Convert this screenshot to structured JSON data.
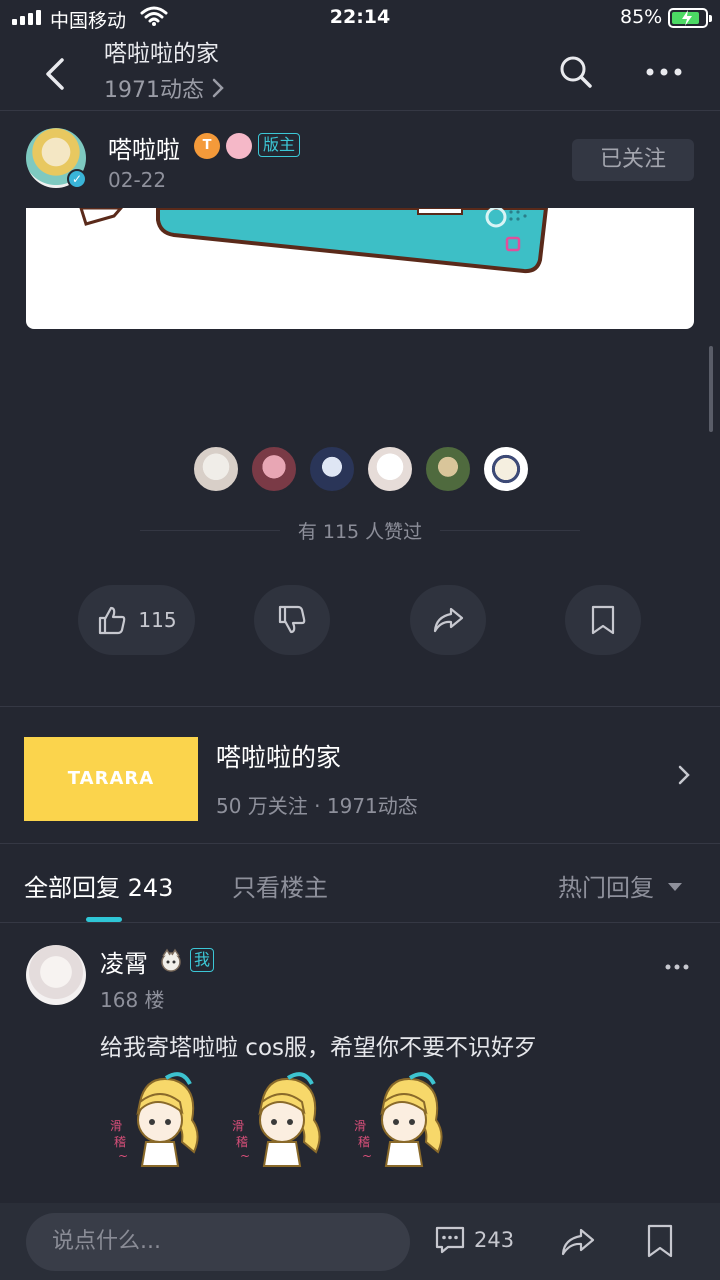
{
  "status_bar": {
    "carrier": "中国移动",
    "time": "22:14",
    "battery_percent": "85%",
    "battery_level": 0.85,
    "charging": true
  },
  "header": {
    "title": "嗒啦啦的家",
    "subtitle": "1971动态",
    "icons": [
      "back-icon",
      "search-icon",
      "more-icon"
    ]
  },
  "post": {
    "author": {
      "name": "嗒啦啦",
      "level_badge": "T",
      "role_badge": "版主",
      "verified": true
    },
    "date": "02-22",
    "follow_label": "已关注",
    "likes_summary": "有 115 人赞过",
    "actions": {
      "like_count": "115",
      "icons": [
        "thumb-up-icon",
        "thumb-down-icon",
        "share-icon",
        "bookmark-icon"
      ]
    }
  },
  "forum": {
    "logo_text": "TARARA",
    "name": "嗒啦啦的家",
    "stats": "50 万关注 · 1971动态",
    "accent": "#fbd44c"
  },
  "tabs": {
    "all_label": "全部回复",
    "all_count": "243",
    "owner_label": "只看楼主",
    "sort_label": "热门回复"
  },
  "comment": {
    "user": "凌霄",
    "me_badge": "我",
    "floor": "168 楼",
    "text": "给我寄塔啦啦 cos服，希望你不要不识好歹"
  },
  "bottom_bar": {
    "input_placeholder": "说点什么...",
    "comment_count": "243"
  },
  "colors": {
    "background": "#242731",
    "accent": "#2fc6d6",
    "badge": "#3cc7d6"
  }
}
